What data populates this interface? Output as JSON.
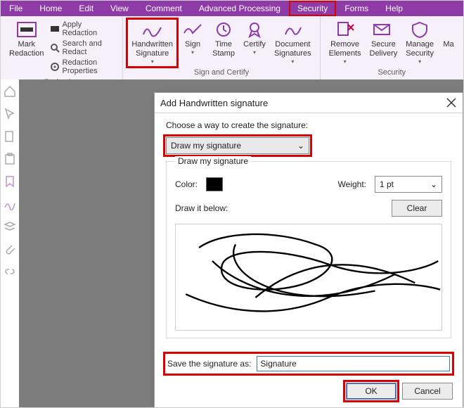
{
  "menu": {
    "items": [
      "File",
      "Home",
      "Edit",
      "View",
      "Comment",
      "Advanced Processing",
      "Security",
      "Forms",
      "Help"
    ],
    "active_index": 6
  },
  "ribbon": {
    "redaction": {
      "mark_label": "Mark\nRedaction",
      "items": [
        "Apply Redaction",
        "Search and Redact",
        "Redaction Properties"
      ],
      "group_label": "Redaction"
    },
    "sign_certify": {
      "buttons": [
        {
          "label": "Handwritten\nSignature",
          "dd": true,
          "hl": true
        },
        {
          "label": "Sign",
          "dd": true
        },
        {
          "label": "Time\nStamp"
        },
        {
          "label": "Certify",
          "dd": true
        },
        {
          "label": "Document\nSignatures",
          "dd": true
        }
      ],
      "group_label": "Sign and Certify"
    },
    "security": {
      "buttons": [
        {
          "label": "Remove\nElements",
          "dd": true
        },
        {
          "label": "Secure\nDelivery"
        },
        {
          "label": "Manage\nSecurity",
          "dd": true
        },
        {
          "label": "Ma",
          "cut": true
        }
      ],
      "group_label": "Security"
    }
  },
  "dialog": {
    "title": "Add Handwritten signature",
    "choose_label": "Choose a way to create the signature:",
    "method_selected": "Draw my signature",
    "panel_title": "Draw my signature",
    "color_label": "Color:",
    "weight_label": "Weight:",
    "weight_value": "1 pt",
    "clear_label": "Clear",
    "draw_below_label": "Draw it below:",
    "save_label": "Save the signature as:",
    "save_value": "Signature",
    "ok": "OK",
    "cancel": "Cancel"
  },
  "colors": {
    "accent": "#8e3ba8",
    "highlight": "#d80000",
    "swatch": "#000000"
  }
}
